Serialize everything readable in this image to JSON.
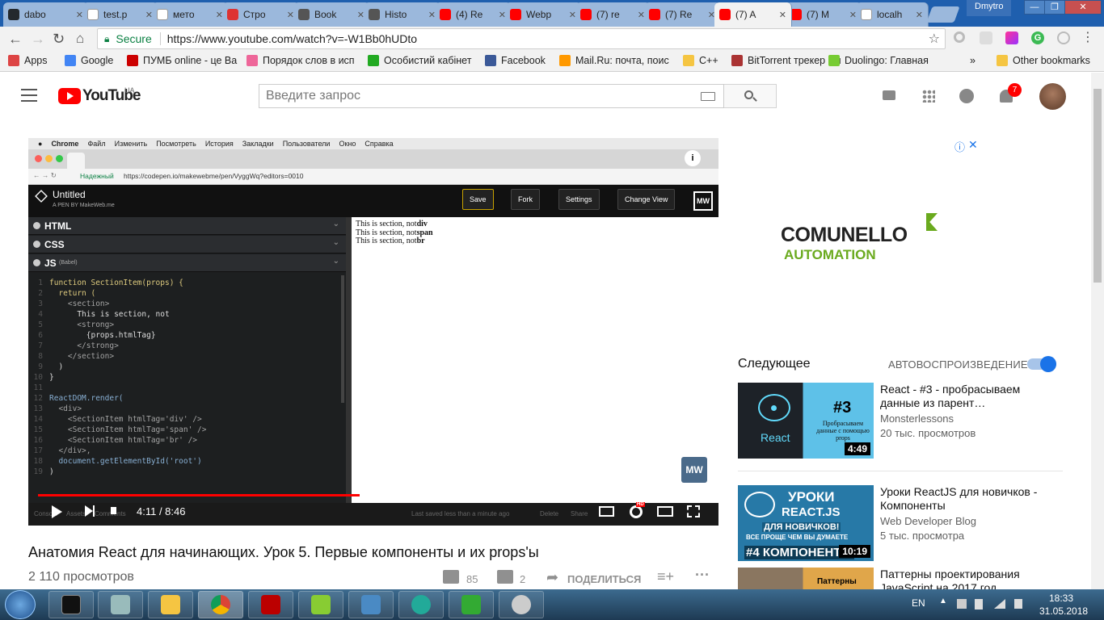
{
  "browser": {
    "tabs": [
      {
        "title": "dabo",
        "icon": "github-icon",
        "color": "#24292e",
        "active": false
      },
      {
        "title": "test.p",
        "icon": "page-icon",
        "color": "#ffffff",
        "active": false
      },
      {
        "title": "мето",
        "icon": "google-icon",
        "color": "#ffffff",
        "active": false
      },
      {
        "title": "Стро",
        "icon": "stroi-icon",
        "color": "#d33",
        "active": false
      },
      {
        "title": "Book",
        "icon": "star-icon",
        "color": "#555",
        "active": false
      },
      {
        "title": "Histo",
        "icon": "history-icon",
        "color": "#555",
        "active": false
      },
      {
        "title": "(4) Re",
        "icon": "youtube-icon",
        "color": "#f00",
        "active": false
      },
      {
        "title": "Webp",
        "icon": "youtube-icon",
        "color": "#f00",
        "active": false
      },
      {
        "title": "(7) re",
        "icon": "youtube-icon",
        "color": "#f00",
        "active": false
      },
      {
        "title": "(7) Re",
        "icon": "youtube-icon",
        "color": "#f00",
        "active": false
      },
      {
        "title": "(7) A",
        "icon": "youtube-icon",
        "color": "#f00",
        "active": true
      },
      {
        "title": "(7) M",
        "icon": "youtube-icon",
        "color": "#f00",
        "active": false
      },
      {
        "title": "localh",
        "icon": "page-icon",
        "color": "#ffffff",
        "active": false
      }
    ],
    "user": "Dmytro",
    "secure_label": "Secure",
    "url": "https://www.youtube.com/watch?v=-W1Bb0hUDto",
    "bookmarks": [
      {
        "label": "Apps",
        "color": "#d44"
      },
      {
        "label": "Google",
        "color": "#4285f4"
      },
      {
        "label": "ПУМБ online - це Ва",
        "color": "#c00"
      },
      {
        "label": "Порядок слов в исп",
        "color": "#e69"
      },
      {
        "label": "Особистий кабінет",
        "color": "#2a2"
      },
      {
        "label": "Facebook",
        "color": "#3b5998"
      },
      {
        "label": "Mail.Ru: почта, поис",
        "color": "#f90"
      },
      {
        "label": "C++",
        "color": "#f5c542"
      },
      {
        "label": "BitTorrent трекер Ru",
        "color": "#a33"
      },
      {
        "label": "Duolingo: Главная",
        "color": "#7c3"
      },
      {
        "label": "»",
        "color": ""
      },
      {
        "label": "Other bookmarks",
        "color": "#f5c542"
      }
    ]
  },
  "youtube": {
    "logo_text": "YouTube",
    "region": "UA",
    "search_placeholder": "Введите запрос",
    "notifications": "7",
    "video": {
      "title": "Анатомия React для начинающих. Урок 5. Первые компоненты и их props'ы",
      "views": "2 110 просмотров",
      "likes": "85",
      "dislikes": "2",
      "share_label": "ПОДЕЛИТЬСЯ",
      "time": "4:11 / 8:46",
      "progress_fraction": 0.48
    },
    "up_next_label": "Следующее",
    "autoplay_label": "АВТОВОСПРОИЗВЕДЕНИЕ",
    "recommendations": [
      {
        "title": "React - #3 - пробрасываем данные из парент…",
        "channel": "Monsterlessons",
        "views": "20 тыс. просмотров",
        "duration": "4:49",
        "thumb_number": "#3",
        "thumb_caption": "Пробрасываем данные с помощью props",
        "thumb_label": "React"
      },
      {
        "title": "Уроки ReactJS для новичков - Компоненты",
        "channel": "Web Developer Blog",
        "views": "5 тыс. просмотра",
        "duration": "10:19",
        "thumb_line1": "УРОКИ",
        "thumb_line2": "REACT.JS",
        "thumb_line3": "ДЛЯ НОВИЧКОВ!",
        "thumb_line4": "ВСЕ ПРОЩЕ ЧЕМ ВЫ ДУМАЕТЕ",
        "thumb_line5": "#4 КОМПОНЕНТЫ"
      },
      {
        "title": "Паттерны проектирования JavaScript на 2017 год",
        "thumb_label": "Паттерны"
      }
    ],
    "ad": {
      "brand": "COMUNELLO",
      "sub": "AUTOMATION"
    }
  },
  "screencast": {
    "mac_menu": [
      "Chrome",
      "Файл",
      "Изменить",
      "Посмотреть",
      "История",
      "Закладки",
      "Пользователи",
      "Окно",
      "Справка"
    ],
    "inner_secure": "Надежный",
    "inner_url": "https://codepen.io/makewebme/pen/VyggWq?editors=0010",
    "pen_title": "Untitled",
    "pen_author": "A PEN BY MakeWeb.me",
    "buttons": [
      "Save",
      "Fork",
      "Settings",
      "Change View"
    ],
    "panels": {
      "html": "HTML",
      "css": "CSS",
      "js": "JS",
      "js_sub": "(Babel)"
    },
    "code": [
      {
        "n": "1",
        "t": "function SectionItem(props) {"
      },
      {
        "n": "2",
        "t": "  return ("
      },
      {
        "n": "3",
        "t": "    <section>"
      },
      {
        "n": "4",
        "t": "      This is section, not"
      },
      {
        "n": "5",
        "t": "      <strong>"
      },
      {
        "n": "6",
        "t": "        {props.htmlTag}"
      },
      {
        "n": "7",
        "t": "      </strong>"
      },
      {
        "n": "8",
        "t": "    </section>"
      },
      {
        "n": "9",
        "t": "  )"
      },
      {
        "n": "10",
        "t": "}"
      },
      {
        "n": "11",
        "t": ""
      },
      {
        "n": "12",
        "t": "ReactDOM.render("
      },
      {
        "n": "13",
        "t": "  <div>"
      },
      {
        "n": "14",
        "t": "    <SectionItem htmlTag='div' />"
      },
      {
        "n": "15",
        "t": "    <SectionItem htmlTag='span' />"
      },
      {
        "n": "16",
        "t": "    <SectionItem htmlTag='br' />"
      },
      {
        "n": "17",
        "t": "  </div>,"
      },
      {
        "n": "18",
        "t": "  document.getElementById('root')"
      },
      {
        "n": "19",
        "t": ")"
      }
    ],
    "preview_lines": [
      {
        "text": "This is section, not",
        "bold": "div"
      },
      {
        "text": "This is section, not",
        "bold": "span"
      },
      {
        "text": "This is section, not",
        "bold": "br"
      }
    ],
    "footer": {
      "console": "Console",
      "assets": "Assets",
      "comments": "Comments",
      "saved": "Last saved less than a minute ago",
      "delete": "Delete",
      "share": "Share"
    }
  },
  "taskbar": {
    "lang": "EN",
    "time": "18:33",
    "date": "31.05.2018"
  }
}
